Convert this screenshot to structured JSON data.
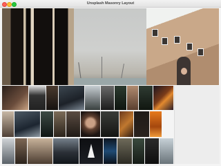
{
  "window": {
    "title": "Unsplash Masonry Layout"
  },
  "colors": {
    "close": "#ff5f57",
    "minimize": "#febc2e",
    "maximize": "#28c840",
    "canvas_background": "#f4f4f4"
  },
  "photos": [
    {
      "name": "photo-building-columns",
      "icon": "photo"
    },
    {
      "name": "photo-overcast-sky",
      "icon": "photo"
    },
    {
      "name": "photo-apartment-woman",
      "icon": "photo"
    }
  ]
}
